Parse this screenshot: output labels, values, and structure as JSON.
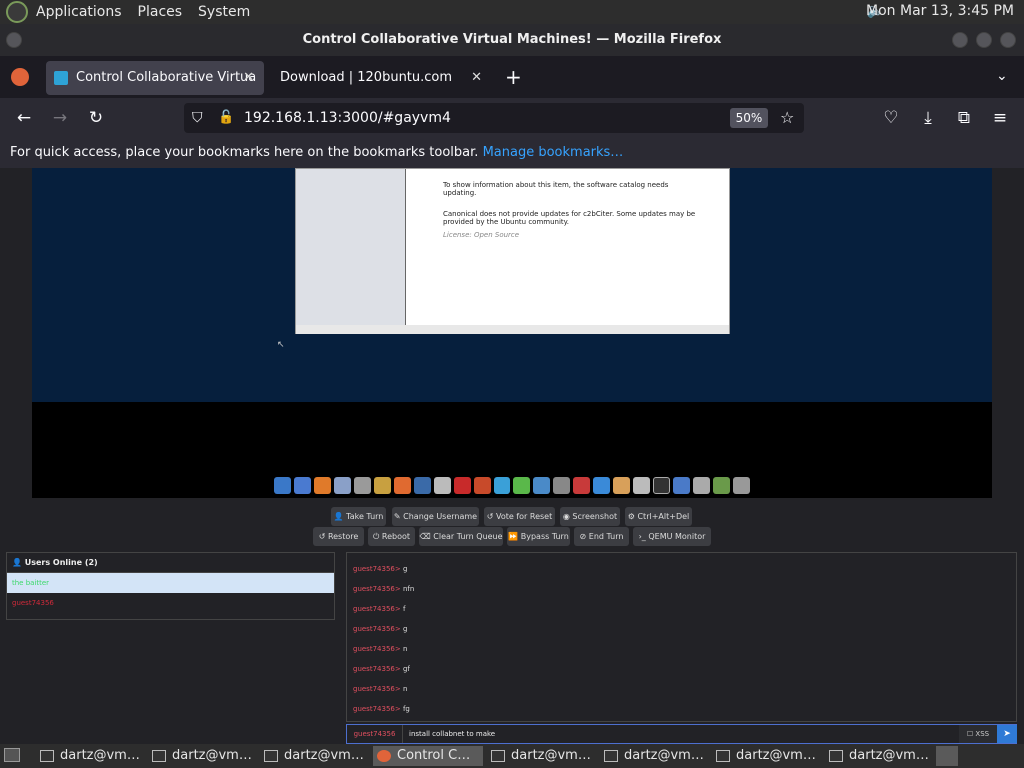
{
  "panel": {
    "menus": [
      "Applications",
      "Places",
      "System"
    ],
    "clock": "Mon Mar 13,  3:45 PM"
  },
  "window": {
    "title": "Control Collaborative Virtual Machines! — Mozilla Firefox"
  },
  "tabs": [
    {
      "label": "Control Collaborative Virtua",
      "active": true
    },
    {
      "label": "Download | 120buntu.com",
      "active": false
    }
  ],
  "url": {
    "value": "192.168.1.13:3000/#gayvm4",
    "zoom": "50%"
  },
  "bookmarks": {
    "message": "For quick access, place your bookmarks here on the bookmarks toolbar.",
    "link": "Manage bookmarks…"
  },
  "catalog": {
    "line1": "To show information about this item, the software catalog needs updating.",
    "line2": "Canonical does not provide updates for c2bCiter. Some updates may be provided by the Ubuntu community.",
    "line3": "License: Open Source"
  },
  "controls": {
    "row1": [
      "Take Turn",
      "Change Username",
      "Vote for Reset",
      "Screenshot",
      "Ctrl+Alt+Del"
    ],
    "row2": [
      "Restore",
      "Reboot",
      "Clear Turn Queue",
      "Bypass Turn",
      "End Turn",
      "QEMU Monitor"
    ]
  },
  "users": {
    "header": "Users Online (2)",
    "list": [
      {
        "name": "the baitter",
        "color": "#3cd96a",
        "highlight": true
      },
      {
        "name": "guest74356",
        "color": "#d02a3a",
        "highlight": false
      }
    ]
  },
  "chat": {
    "messages": [
      {
        "user": "guest74356",
        "text": "g"
      },
      {
        "user": "guest74356",
        "text": "nfn"
      },
      {
        "user": "guest74356",
        "text": "f"
      },
      {
        "user": "guest74356",
        "text": "g"
      },
      {
        "user": "guest74356",
        "text": "n"
      },
      {
        "user": "guest74356",
        "text": "gf"
      },
      {
        "user": "guest74356",
        "text": "n"
      },
      {
        "user": "guest74356",
        "text": "fg"
      }
    ],
    "input_user": "guest74356",
    "input_value": "install collabnet to make",
    "xss_label": "XSS"
  },
  "taskbar": {
    "items": [
      {
        "label": "dartz@vm…",
        "active": false
      },
      {
        "label": "dartz@vm…",
        "active": false
      },
      {
        "label": "dartz@vm…",
        "active": false
      },
      {
        "label": "Control C…",
        "active": true
      },
      {
        "label": "dartz@vm…",
        "active": false
      },
      {
        "label": "dartz@vm…",
        "active": false
      },
      {
        "label": "dartz@vm…",
        "active": false
      },
      {
        "label": "dartz@vm…",
        "active": false
      }
    ]
  }
}
